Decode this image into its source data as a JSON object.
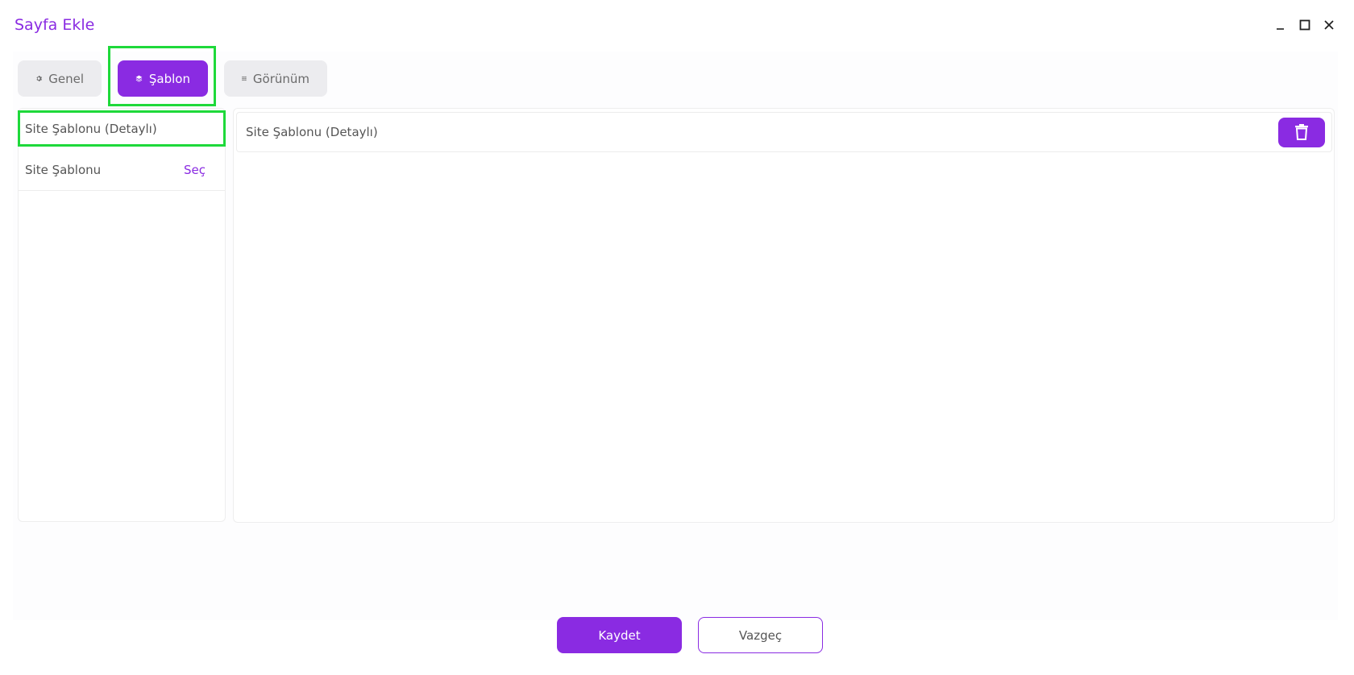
{
  "window": {
    "title": "Sayfa Ekle",
    "controls": [
      "minimize-icon",
      "maximize-icon",
      "close-icon"
    ]
  },
  "tabs": [
    {
      "label": "Genel",
      "icon": "gear-icon",
      "active": false
    },
    {
      "label": "Şablon",
      "icon": "layers-icon",
      "active": true
    },
    {
      "label": "Görünüm",
      "icon": "grid-icon",
      "active": false
    }
  ],
  "template_list": {
    "items": [
      {
        "label": "Site Şablonu (Detaylı)",
        "action": ""
      },
      {
        "label": "Site Şablonu",
        "action": "Seç"
      }
    ]
  },
  "selected": {
    "label": "Site Şablonu (Detaylı)",
    "delete_icon": "trash-icon"
  },
  "footer": {
    "save_label": "Kaydet",
    "cancel_label": "Vazgeç"
  },
  "colors": {
    "accent": "#8a2be2",
    "highlight": "#1ed93a",
    "tab_inactive": "#ececef"
  }
}
